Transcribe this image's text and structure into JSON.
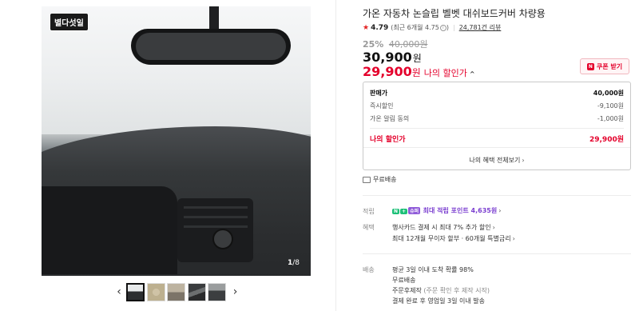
{
  "gallery": {
    "badge": "별다섯일",
    "counter_current": "1",
    "counter_total": "/8",
    "prev_arrow": "‹",
    "next_arrow": "›"
  },
  "product": {
    "title": "가온 자동차 논슬립 벨벳 대쉬보드커버 차량용",
    "rating_score": "4.79",
    "rating_recent": "(최근 6개월 4.75",
    "rating_recent_end": ")",
    "review_count": "24,781건 리뷰",
    "discount_pct": "25%",
    "original_price": "40,000원",
    "price": "30,900",
    "price_unit": "원",
    "my_price": "29,900",
    "my_price_unit": "원",
    "my_price_label": "나의 할인가",
    "my_price_caret": "^"
  },
  "coupon": {
    "badge": "N",
    "label": "쿠폰 받기"
  },
  "price_box": {
    "rows": [
      {
        "label": "판매가",
        "value": "40,000원"
      },
      {
        "label": "즉시할인",
        "value": "-9,100원"
      },
      {
        "label": "가온 알림 동의",
        "value": "-1,000원"
      }
    ],
    "my_price": {
      "label": "나의 할인가",
      "value": "29,900원"
    },
    "benefit_link": "나의 혜택 전체보기"
  },
  "shipping_badge": "무료배송",
  "points": {
    "label": "적립",
    "badge_n": "N",
    "badge_plus": "+",
    "badge_p": "슈퍼",
    "text": "최대 적립 포인트 4,635원"
  },
  "benefits": {
    "label": "혜택",
    "line1": "행사카드 결제 시 최대 7% 추가 할인",
    "line2": "최대 12개월 무이자 할부 · 60개월 특별금리"
  },
  "delivery": {
    "label": "배송",
    "line1": "평균 3일 이내 도착 확률 98%",
    "line2": "무료배송",
    "line3a": "주문후제작",
    "line3b": " (주문 확인 후 제작 시작)",
    "line4": "결제 완료 후 영업일 3일 이내 발송"
  }
}
